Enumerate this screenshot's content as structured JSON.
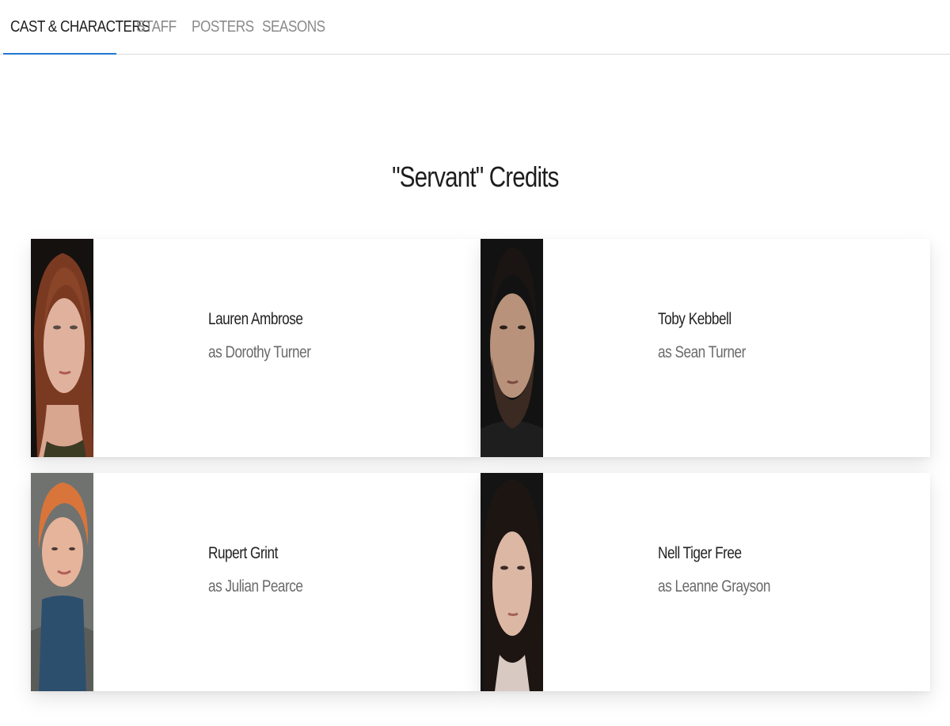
{
  "tabs": [
    {
      "label": "CAST & CHARACTERS",
      "active": true
    },
    {
      "label": "STAFF",
      "active": false
    },
    {
      "label": "POSTERS",
      "active": false
    },
    {
      "label": "SEASONS",
      "active": false
    }
  ],
  "title": "\"Servant\" Credits",
  "cast": [
    {
      "actor": "Lauren Ambrose",
      "character": "as Dorothy Turner"
    },
    {
      "actor": "Toby Kebbell",
      "character": "as Sean Turner"
    },
    {
      "actor": "Rupert Grint",
      "character": "as Julian Pearce"
    },
    {
      "actor": "Nell Tiger Free",
      "character": "as Leanne Grayson"
    }
  ],
  "colors": {
    "accent": "#1f78d1",
    "active_tab_text": "#1f1f1f",
    "inactive_tab_text": "#8a8a8a"
  }
}
